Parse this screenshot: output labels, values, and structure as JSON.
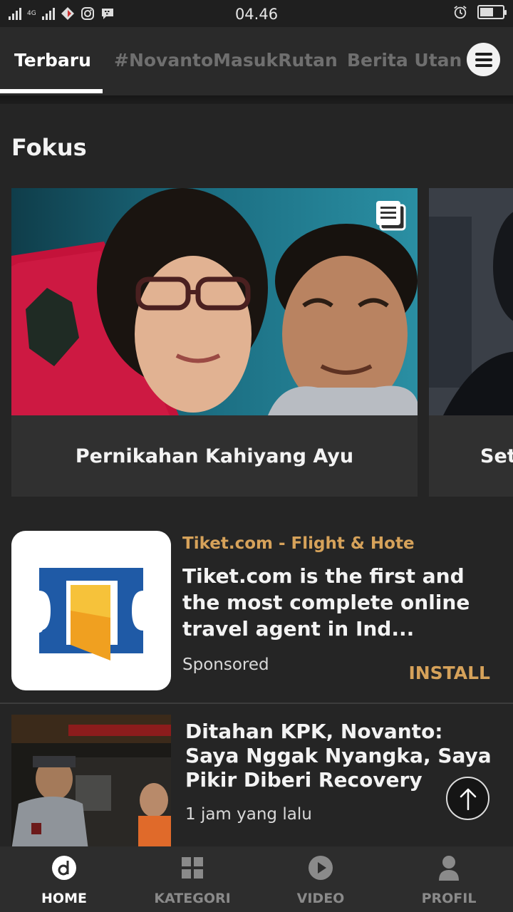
{
  "status_bar": {
    "network": "4G",
    "time": "04.46"
  },
  "tabs": [
    {
      "label": "Terbaru",
      "active": true
    },
    {
      "label": "#NovantoMasukRutan",
      "active": false
    },
    {
      "label": "Berita Utan",
      "active": false
    }
  ],
  "fokus": {
    "title": "Fokus",
    "cards": [
      {
        "caption": "Pernikahan Kahiyang Ayu",
        "icon": "gallery-icon"
      },
      {
        "caption": "Set"
      }
    ]
  },
  "ad": {
    "brand": "Tiket.com - Flight & Hote",
    "text": "Tiket.com is the first and the most complete online travel agent in Ind...",
    "sponsored": "Sponsored",
    "install": "INSTALL"
  },
  "news": {
    "title": "Ditahan KPK, Novanto: Saya Nggak Nyangka, Saya Pikir Diberi Recovery",
    "time": "1 jam yang lalu"
  },
  "bottom_nav": [
    {
      "label": "HOME",
      "icon": "home-d-icon",
      "active": true
    },
    {
      "label": "KATEGORI",
      "icon": "grid-icon",
      "active": false
    },
    {
      "label": "VIDEO",
      "icon": "play-icon",
      "active": false
    },
    {
      "label": "PROFIL",
      "icon": "person-icon",
      "active": false
    }
  ],
  "colors": {
    "accent": "#d6a25a",
    "background": "#1e1e1e",
    "panel": "#252525"
  }
}
